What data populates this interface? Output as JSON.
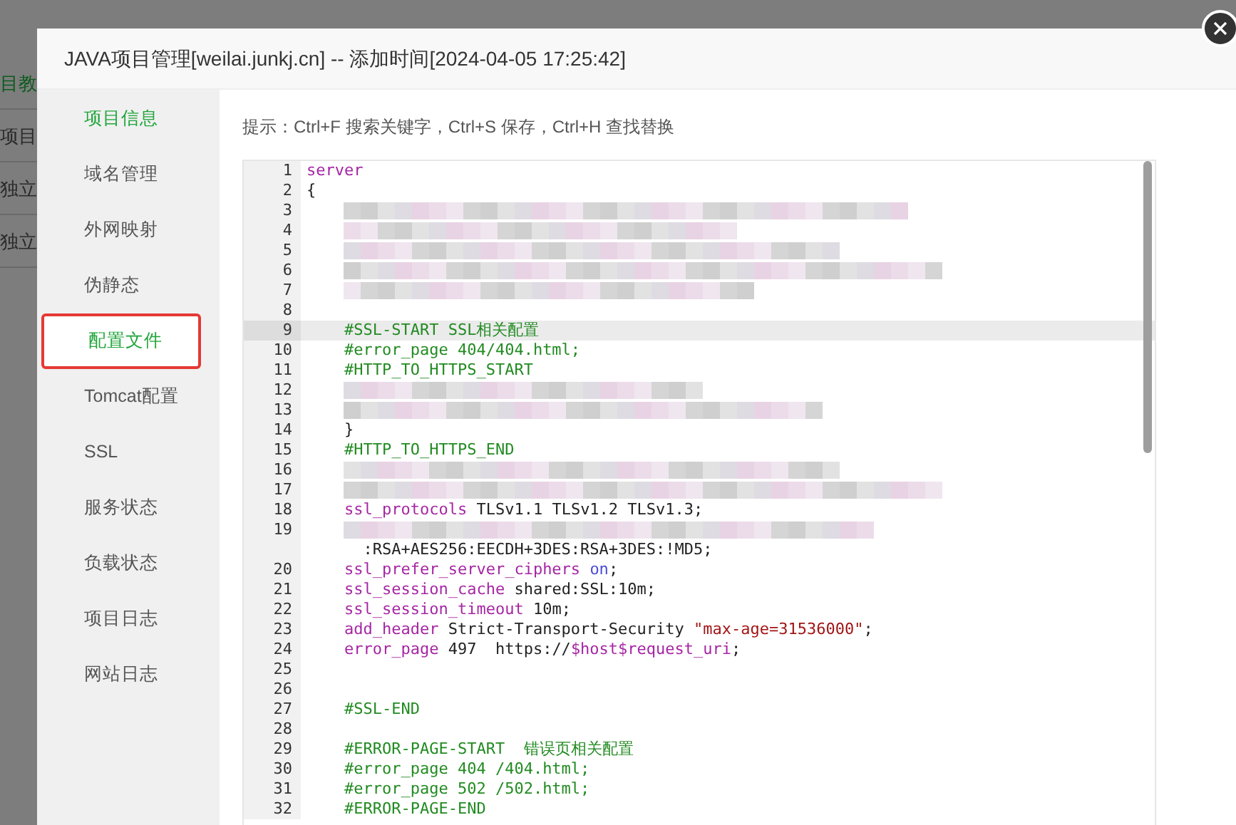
{
  "background_page": {
    "items": [
      {
        "label": "目教",
        "kind": "link"
      },
      {
        "label": "项目",
        "kind": "text"
      },
      {
        "label": "独立",
        "kind": "text"
      },
      {
        "label": "独立",
        "kind": "text"
      }
    ]
  },
  "dialog": {
    "title": "JAVA项目管理[weilai.junkj.cn] -- 添加时间[2024-04-05 17:25:42]",
    "sidebar": {
      "items": [
        {
          "label": "项目信息",
          "selected": false,
          "color": "#20a53a",
          "annotated": false
        },
        {
          "label": "域名管理",
          "selected": false,
          "color": "#555555",
          "annotated": false
        },
        {
          "label": "外网映射",
          "selected": false,
          "color": "#555555",
          "annotated": false
        },
        {
          "label": "伪静态",
          "selected": false,
          "color": "#555555",
          "annotated": false
        },
        {
          "label": "配置文件",
          "selected": true,
          "color": "#20a53a",
          "annotated": true
        },
        {
          "label": "Tomcat配置",
          "selected": false,
          "color": "#555555",
          "annotated": false
        },
        {
          "label": "SSL",
          "selected": false,
          "color": "#555555",
          "annotated": false
        },
        {
          "label": "服务状态",
          "selected": false,
          "color": "#555555",
          "annotated": false
        },
        {
          "label": "负载状态",
          "selected": false,
          "color": "#555555",
          "annotated": false
        },
        {
          "label": "项目日志",
          "selected": false,
          "color": "#555555",
          "annotated": false
        },
        {
          "label": "网站日志",
          "selected": false,
          "color": "#555555",
          "annotated": false
        }
      ]
    },
    "hint": "提示：Ctrl+F 搜索关键字，Ctrl+S 保存，Ctrl+H 查找替换",
    "editor": {
      "lines": [
        {
          "number": "1",
          "kind": "code",
          "active": false,
          "segments": [
            {
              "kind": "keyword",
              "text": "server"
            }
          ]
        },
        {
          "number": "2",
          "kind": "code",
          "active": false,
          "segments": [
            {
              "kind": "plain",
              "text": "{"
            }
          ]
        },
        {
          "number": "3",
          "kind": "blurred",
          "active": false
        },
        {
          "number": "4",
          "kind": "blurred",
          "active": false
        },
        {
          "number": "5",
          "kind": "blurred",
          "active": false
        },
        {
          "number": "6",
          "kind": "blurred",
          "active": false
        },
        {
          "number": "7",
          "kind": "blurred",
          "active": false
        },
        {
          "number": "8",
          "kind": "code",
          "active": false
        },
        {
          "number": "9",
          "kind": "code",
          "active": true,
          "segments": [
            {
              "kind": "comment",
              "text": "    #SSL-START SSL相关配置"
            }
          ]
        },
        {
          "number": "10",
          "kind": "code",
          "active": false,
          "segments": [
            {
              "kind": "comment",
              "text": "    #error_page 404/404.html;"
            }
          ]
        },
        {
          "number": "11",
          "kind": "code",
          "active": false,
          "segments": [
            {
              "kind": "comment",
              "text": "    #HTTP_TO_HTTPS_START"
            }
          ]
        },
        {
          "number": "12",
          "kind": "blurred",
          "active": false
        },
        {
          "number": "13",
          "kind": "blurred",
          "active": false
        },
        {
          "number": "14",
          "kind": "code",
          "active": false,
          "segments": [
            {
              "kind": "plain",
              "text": "    }"
            }
          ]
        },
        {
          "number": "15",
          "kind": "code",
          "active": false,
          "segments": [
            {
              "kind": "comment",
              "text": "    #HTTP_TO_HTTPS_END"
            }
          ]
        },
        {
          "number": "16",
          "kind": "blurred",
          "active": false
        },
        {
          "number": "17",
          "kind": "blurred",
          "active": false
        },
        {
          "number": "18",
          "kind": "code",
          "active": false,
          "segments": [
            {
              "kind": "keyword",
              "text": "    ssl_protocols"
            },
            {
              "kind": "plain",
              "text": " TLSv1.1 TLSv1.2 TLSv1.3;"
            }
          ]
        },
        {
          "number": "19",
          "kind": "blurred",
          "active": false
        },
        {
          "kind": "code",
          "active": false,
          "segments": [
            {
              "kind": "plain",
              "text": "      :RSA+AES256:EECDH+3DES:RSA+3DES:!MD5;"
            }
          ]
        },
        {
          "number": "20",
          "kind": "code",
          "active": false,
          "segments": [
            {
              "kind": "keyword",
              "text": "    ssl_prefer_server_ciphers "
            },
            {
              "kind": "atom",
              "text": "on"
            },
            {
              "kind": "plain",
              "text": ";"
            }
          ]
        },
        {
          "number": "21",
          "kind": "code",
          "active": false,
          "segments": [
            {
              "kind": "keyword",
              "text": "    ssl_session_cache"
            },
            {
              "kind": "plain",
              "text": " shared:SSL:10m;"
            }
          ]
        },
        {
          "number": "22",
          "kind": "code",
          "active": false,
          "segments": [
            {
              "kind": "keyword",
              "text": "    ssl_session_timeout"
            },
            {
              "kind": "plain",
              "text": " 10m;"
            }
          ]
        },
        {
          "number": "23",
          "kind": "code",
          "active": false,
          "segments": [
            {
              "kind": "keyword",
              "text": "    add_header"
            },
            {
              "kind": "plain",
              "text": " Strict-Transport-Security "
            },
            {
              "kind": "string",
              "text": "\"max-age=31536000\""
            },
            {
              "kind": "plain",
              "text": ";"
            }
          ]
        },
        {
          "number": "24",
          "kind": "code",
          "active": false,
          "segments": [
            {
              "kind": "keyword",
              "text": "    error_page"
            },
            {
              "kind": "plain",
              "text": " 497  https://"
            },
            {
              "kind": "variable",
              "text": "$host$request_uri"
            },
            {
              "kind": "plain",
              "text": ";"
            }
          ]
        },
        {
          "number": "25",
          "kind": "code",
          "active": false
        },
        {
          "number": "26",
          "kind": "code",
          "active": false
        },
        {
          "number": "27",
          "kind": "code",
          "active": false,
          "segments": [
            {
              "kind": "comment",
              "text": "    #SSL-END"
            }
          ]
        },
        {
          "number": "28",
          "kind": "code",
          "active": false
        },
        {
          "number": "29",
          "kind": "code",
          "active": false,
          "segments": [
            {
              "kind": "comment",
              "text": "    #ERROR-PAGE-START  错误页相关配置"
            }
          ]
        },
        {
          "number": "30",
          "kind": "code",
          "active": false,
          "segments": [
            {
              "kind": "comment",
              "text": "    #error_page 404 /404.html;"
            }
          ]
        },
        {
          "number": "31",
          "kind": "code",
          "active": false,
          "segments": [
            {
              "kind": "comment",
              "text": "    #error_page 502 /502.html;"
            }
          ]
        },
        {
          "number": "32",
          "kind": "code",
          "active": false,
          "segments": [
            {
              "kind": "comment",
              "text": "    #ERROR-PAGE-END"
            }
          ]
        }
      ]
    }
  }
}
